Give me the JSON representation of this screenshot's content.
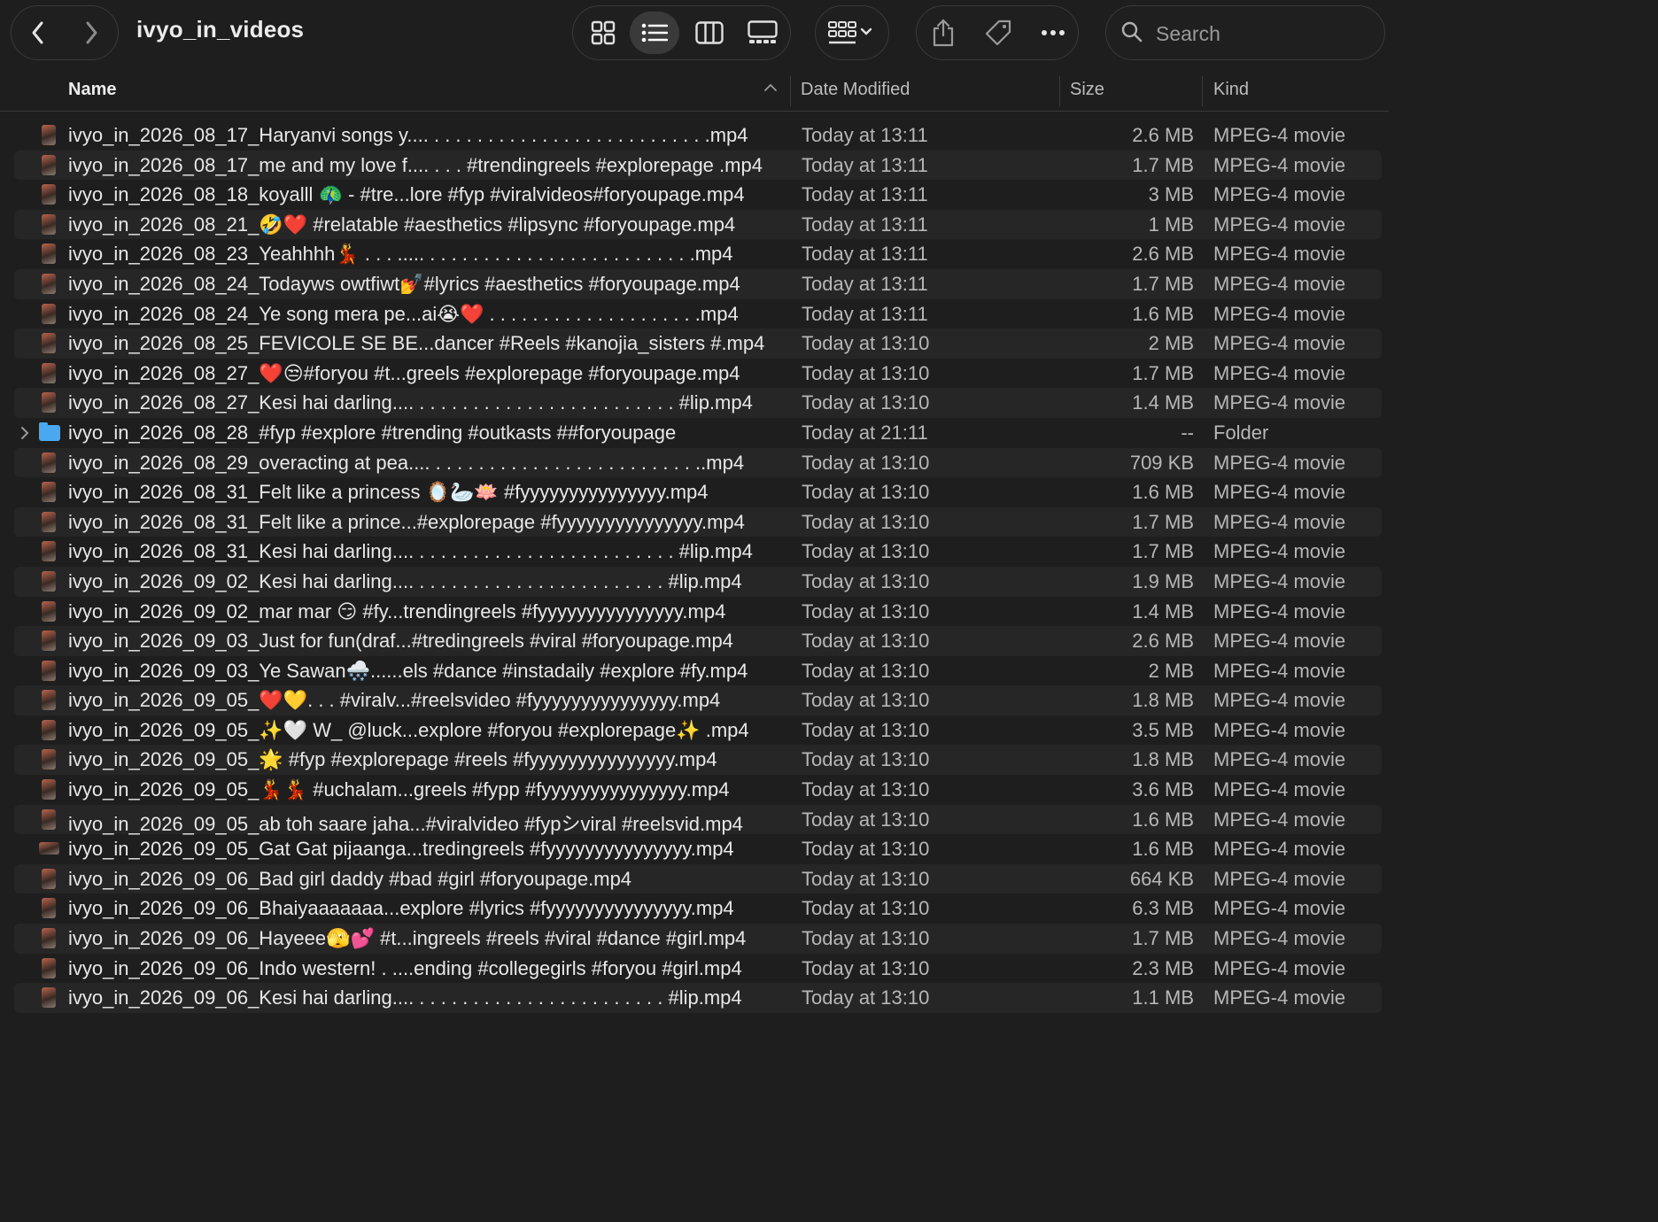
{
  "window": {
    "title": "ivyo_in_videos"
  },
  "toolbar": {
    "search_placeholder": "Search",
    "view_modes": [
      "icons",
      "list",
      "columns",
      "gallery"
    ],
    "active_view": "list"
  },
  "columns": {
    "name": "Name",
    "date": "Date Modified",
    "size": "Size",
    "kind": "Kind"
  },
  "files": [
    {
      "name": "ivyo_in_2026_08_17_Haryanvi songs y.... . . . . . . . . . . . . . . . . . . . . . . . . . .mp4",
      "date": "Today at 13:11",
      "size": "2.6 MB",
      "kind": "MPEG-4 movie"
    },
    {
      "name": "ivyo_in_2026_08_17_me and my love f.... . . . #trendingreels #explorepage .mp4",
      "date": "Today at 13:11",
      "size": "1.7 MB",
      "kind": "MPEG-4 movie"
    },
    {
      "name": "ivyo_in_2026_08_18_koyalll 🦚 - #tre...lore #fyp #viralvideos#foryoupage.mp4",
      "date": "Today at 13:11",
      "size": "3 MB",
      "kind": "MPEG-4 movie"
    },
    {
      "name": "ivyo_in_2026_08_21_🤣❤️ #relatable #aesthetics #lipsync #foryoupage.mp4",
      "date": "Today at 13:11",
      "size": "1 MB",
      "kind": "MPEG-4 movie"
    },
    {
      "name": "ivyo_in_2026_08_23_Yeahhhh💃 . . . ..... . . . . . . . . . . . . . . . . . . . . . . . . .mp4",
      "date": "Today at 13:11",
      "size": "2.6 MB",
      "kind": "MPEG-4 movie"
    },
    {
      "name": "ivyo_in_2026_08_24_Todayws owtfiwt💅#lyrics #aesthetics #foryoupage.mp4",
      "date": "Today at 13:11",
      "size": "1.7 MB",
      "kind": "MPEG-4 movie"
    },
    {
      "name": "ivyo_in_2026_08_24_Ye song mera pe...ai😭❤️ . . . . . . . . . . . . . . . . . . . .mp4",
      "date": "Today at 13:11",
      "size": "1.6 MB",
      "kind": "MPEG-4 movie"
    },
    {
      "name": "ivyo_in_2026_08_25_FEVICOLE SE BE...dancer #Reels #kanojia_sisters #.mp4",
      "date": "Today at 13:10",
      "size": "2 MB",
      "kind": "MPEG-4 movie"
    },
    {
      "name": "ivyo_in_2026_08_27_❤️😒#foryou #t...greels #explorepage #foryoupage.mp4",
      "date": "Today at 13:10",
      "size": "1.7 MB",
      "kind": "MPEG-4 movie"
    },
    {
      "name": "ivyo_in_2026_08_27_Kesi hai darling.... . . . . . . . . . . . . . . . . . . . . . . . . #lip.mp4",
      "date": "Today at 13:10",
      "size": "1.4 MB",
      "kind": "MPEG-4 movie"
    },
    {
      "name": "ivyo_in_2026_08_28_#fyp #explore #trending #outkasts ##foryoupage",
      "date": "Today at 21:11",
      "size": "--",
      "kind": "Folder",
      "folder": true
    },
    {
      "name": "ivyo_in_2026_08_29_overacting at pea.... . . . . . . . . . . . . . . . . . . . . . . . . ..mp4",
      "date": "Today at 13:10",
      "size": "709 KB",
      "kind": "MPEG-4 movie"
    },
    {
      "name": "ivyo_in_2026_08_31_Felt like a princess 🪞🦢🪷 #fyyyyyyyyyyyyyyy.mp4",
      "date": "Today at 13:10",
      "size": "1.6 MB",
      "kind": "MPEG-4 movie"
    },
    {
      "name": "ivyo_in_2026_08_31_Felt like a prince...#explorepage #fyyyyyyyyyyyyyyy.mp4",
      "date": "Today at 13:10",
      "size": "1.7 MB",
      "kind": "MPEG-4 movie"
    },
    {
      "name": "ivyo_in_2026_08_31_Kesi hai darling.... . . . . . . . . . . . . . . . . . . . . . . . . #lip.mp4",
      "date": "Today at 13:10",
      "size": "1.7 MB",
      "kind": "MPEG-4 movie"
    },
    {
      "name": "ivyo_in_2026_09_02_Kesi hai darling.... . . . . . . . . . . . . . . . . . . . . . . . #lip.mp4",
      "date": "Today at 13:10",
      "size": "1.9 MB",
      "kind": "MPEG-4 movie"
    },
    {
      "name": "ivyo_in_2026_09_02_mar mar 😏 #fy...trendingreels #fyyyyyyyyyyyyyyy.mp4",
      "date": "Today at 13:10",
      "size": "1.4 MB",
      "kind": "MPEG-4 movie"
    },
    {
      "name": "ivyo_in_2026_09_03_Just for fun(draf...#tredingreels #viral #foryoupage.mp4",
      "date": "Today at 13:10",
      "size": "2.6 MB",
      "kind": "MPEG-4 movie"
    },
    {
      "name": "ivyo_in_2026_09_03_Ye Sawan🌨️......els #dance #instadaily #explore #fy.mp4",
      "date": "Today at 13:10",
      "size": "2 MB",
      "kind": "MPEG-4 movie"
    },
    {
      "name": "ivyo_in_2026_09_05_❤️💛. . . #viralv...#reelsvideo #fyyyyyyyyyyyyyyy.mp4",
      "date": "Today at 13:10",
      "size": "1.8 MB",
      "kind": "MPEG-4 movie"
    },
    {
      "name": "ivyo_in_2026_09_05_✨🤍 W_ @luck...explore #foryou #explorepage✨ .mp4",
      "date": "Today at 13:10",
      "size": "3.5 MB",
      "kind": "MPEG-4 movie"
    },
    {
      "name": "ivyo_in_2026_09_05_🌟 #fyp #explorepage #reels #fyyyyyyyyyyyyyyy.mp4",
      "date": "Today at 13:10",
      "size": "1.8 MB",
      "kind": "MPEG-4 movie"
    },
    {
      "name": "ivyo_in_2026_09_05_💃💃 #uchalam...greels #fypp #fyyyyyyyyyyyyyyy.mp4",
      "date": "Today at 13:10",
      "size": "3.6 MB",
      "kind": "MPEG-4 movie"
    },
    {
      "name": "ivyo_in_2026_09_05_ab toh saare jaha...#viralvideo #fypシviral #reelsvid.mp4",
      "date": "Today at 13:10",
      "size": "1.6 MB",
      "kind": "MPEG-4 movie"
    },
    {
      "name": "ivyo_in_2026_09_05_Gat Gat pijaanga...tredingreels #fyyyyyyyyyyyyyyy.mp4",
      "date": "Today at 13:10",
      "size": "1.6 MB",
      "kind": "MPEG-4 movie",
      "wide": true
    },
    {
      "name": "ivyo_in_2026_09_06_Bad girl daddy #bad #girl #foryoupage.mp4",
      "date": "Today at 13:10",
      "size": "664 KB",
      "kind": "MPEG-4 movie"
    },
    {
      "name": "ivyo_in_2026_09_06_Bhaiyaaaaaaa...explore #lyrics #fyyyyyyyyyyyyyyy.mp4",
      "date": "Today at 13:10",
      "size": "6.3 MB",
      "kind": "MPEG-4 movie"
    },
    {
      "name": "ivyo_in_2026_09_06_Hayeee🫣💕 #t...ingreels #reels #viral #dance #girl.mp4",
      "date": "Today at 13:10",
      "size": "1.7 MB",
      "kind": "MPEG-4 movie"
    },
    {
      "name": "ivyo_in_2026_09_06_Indo western! . ....ending #collegegirls #foryou #girl.mp4",
      "date": "Today at 13:10",
      "size": "2.3 MB",
      "kind": "MPEG-4 movie"
    },
    {
      "name": "ivyo_in_2026_09_06_Kesi hai darling.... . . . . . . . . . . . . . . . . . . . . . . . #lip.mp4",
      "date": "Today at 13:10",
      "size": "1.1 MB",
      "kind": "MPEG-4 movie"
    }
  ]
}
